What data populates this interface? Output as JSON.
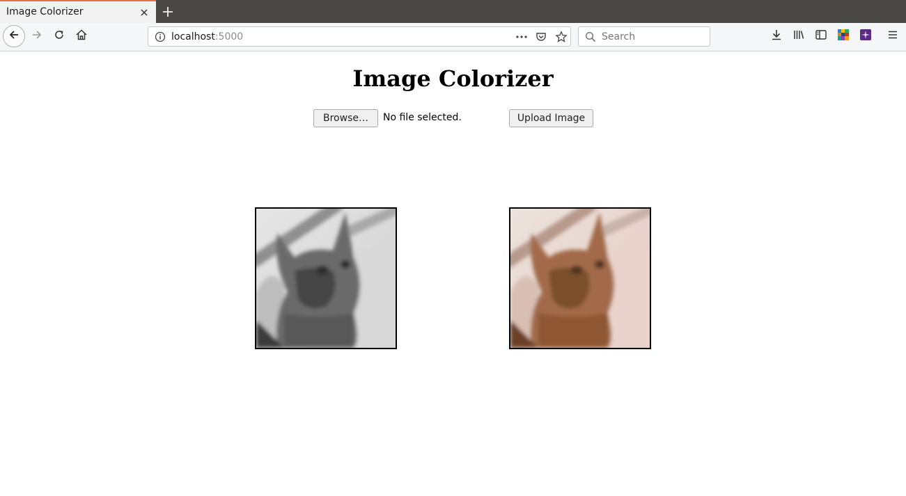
{
  "browser": {
    "tab_title": "Image Colorizer",
    "url_host": "localhost",
    "url_port": ":5000",
    "search_placeholder": "Search",
    "icons": [
      "back-icon",
      "forward-icon",
      "reload-icon",
      "home-icon",
      "site-info-icon",
      "page-actions-icon",
      "pocket-icon",
      "bookmark-star-icon",
      "search-icon",
      "download-icon",
      "library-icon",
      "sidebar-icon",
      "extension-icon",
      "extension-icon-2",
      "menu-icon",
      "close-icon",
      "new-tab-icon"
    ]
  },
  "page": {
    "title": "Image Colorizer",
    "browse_label": "Browse…",
    "file_status": "No file selected.",
    "upload_label": "Upload Image"
  },
  "images": {
    "grayscale": "grayscale-cat-image",
    "colorized": "colorized-cat-image"
  }
}
